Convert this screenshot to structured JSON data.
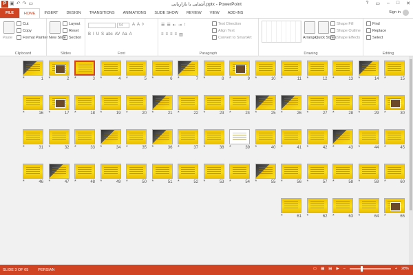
{
  "app": {
    "logo": "P",
    "title": "آشنایی با بازاریابی.pptx - PowerPoint",
    "window_controls": [
      "?",
      "▭",
      "–",
      "□",
      "✕"
    ]
  },
  "tabs": [
    {
      "label": "FILE"
    },
    {
      "label": "HOME"
    },
    {
      "label": "INSERT"
    },
    {
      "label": "DESIGN"
    },
    {
      "label": "TRANSITIONS"
    },
    {
      "label": "ANIMATIONS"
    },
    {
      "label": "SLIDE SHOW"
    },
    {
      "label": "REVIEW"
    },
    {
      "label": "VIEW"
    },
    {
      "label": "ADD-INS"
    }
  ],
  "signin": "Sign in",
  "ribbon": {
    "clipboard": {
      "label": "Clipboard",
      "paste": "Paste",
      "cut": "Cut",
      "copy": "Copy",
      "format_painter": "Format Painter"
    },
    "slides": {
      "label": "Slides",
      "new_slide": "New Slide",
      "layout": "Layout",
      "reset": "Reset",
      "section": "Section"
    },
    "font": {
      "label": "Font",
      "size": "54"
    },
    "paragraph": {
      "label": "Paragraph",
      "text_direction": "Text Direction",
      "align_text": "Align Text",
      "smartart": "Convert to SmartArt"
    },
    "drawing": {
      "label": "Drawing",
      "arrange": "Arrange",
      "quick_styles": "Quick Styles",
      "shape_fill": "Shape Fill",
      "shape_outline": "Shape Outline",
      "shape_effects": "Shape Effects"
    },
    "editing": {
      "label": "Editing",
      "find": "Find",
      "replace": "Replace",
      "select": "Select"
    }
  },
  "slides": [
    {
      "n": "15",
      "style": "y"
    },
    {
      "n": "14",
      "style": "dark"
    },
    {
      "n": "13",
      "style": "y"
    },
    {
      "n": "12",
      "style": "y"
    },
    {
      "n": "11",
      "style": "y"
    },
    {
      "n": "10",
      "style": "y"
    },
    {
      "n": "9",
      "style": "pic"
    },
    {
      "n": "8",
      "style": "y"
    },
    {
      "n": "7",
      "style": "dark"
    },
    {
      "n": "6",
      "style": "y"
    },
    {
      "n": "5",
      "style": "y"
    },
    {
      "n": "4",
      "style": "y"
    },
    {
      "n": "3",
      "style": "y",
      "selected": true
    },
    {
      "n": "2",
      "style": "pic"
    },
    {
      "n": "1",
      "style": "dark"
    },
    {
      "n": "30",
      "style": "pic"
    },
    {
      "n": "29",
      "style": "y"
    },
    {
      "n": "28",
      "style": "y"
    },
    {
      "n": "27",
      "style": "y"
    },
    {
      "n": "26",
      "style": "dark"
    },
    {
      "n": "25",
      "style": "dark"
    },
    {
      "n": "24",
      "style": "y"
    },
    {
      "n": "23",
      "style": "y"
    },
    {
      "n": "22",
      "style": "y"
    },
    {
      "n": "21",
      "style": "dark"
    },
    {
      "n": "20",
      "style": "y"
    },
    {
      "n": "19",
      "style": "y"
    },
    {
      "n": "18",
      "style": "y"
    },
    {
      "n": "17",
      "style": "pic"
    },
    {
      "n": "16",
      "style": "y"
    },
    {
      "n": "45",
      "style": "y"
    },
    {
      "n": "44",
      "style": "y"
    },
    {
      "n": "43",
      "style": "dark"
    },
    {
      "n": "42",
      "style": "y"
    },
    {
      "n": "41",
      "style": "y"
    },
    {
      "n": "40",
      "style": "y"
    },
    {
      "n": "39",
      "style": "white"
    },
    {
      "n": "38",
      "style": "y"
    },
    {
      "n": "37",
      "style": "y"
    },
    {
      "n": "36",
      "style": "dark"
    },
    {
      "n": "35",
      "style": "y"
    },
    {
      "n": "34",
      "style": "dark"
    },
    {
      "n": "33",
      "style": "y"
    },
    {
      "n": "32",
      "style": "y"
    },
    {
      "n": "31",
      "style": "y"
    },
    {
      "n": "60",
      "style": "y"
    },
    {
      "n": "59",
      "style": "y"
    },
    {
      "n": "58",
      "style": "y"
    },
    {
      "n": "57",
      "style": "y"
    },
    {
      "n": "56",
      "style": "y"
    },
    {
      "n": "55",
      "style": "dark"
    },
    {
      "n": "54",
      "style": "y"
    },
    {
      "n": "53",
      "style": "y"
    },
    {
      "n": "52",
      "style": "y"
    },
    {
      "n": "51",
      "style": "y"
    },
    {
      "n": "50",
      "style": "y"
    },
    {
      "n": "49",
      "style": "y"
    },
    {
      "n": "48",
      "style": "y"
    },
    {
      "n": "47",
      "style": "dark"
    },
    {
      "n": "46",
      "style": "y"
    },
    {
      "n": "65",
      "style": "pic"
    },
    {
      "n": "64",
      "style": "y"
    },
    {
      "n": "63",
      "style": "y"
    },
    {
      "n": "62",
      "style": "y"
    },
    {
      "n": "61",
      "style": "y"
    }
  ],
  "status": {
    "slide": "SLIDE 3 OF 65",
    "language": "PERSIAN",
    "zoom": "28%",
    "zoom_fraction": 0.28
  },
  "colors": {
    "accent": "#d04423",
    "slide_yellow": "#f2c500"
  }
}
